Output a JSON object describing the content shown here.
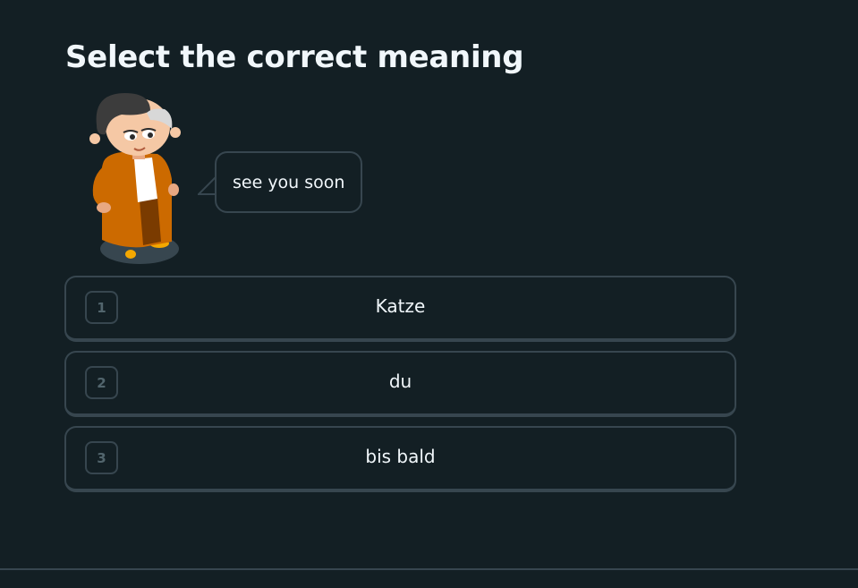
{
  "prompt": {
    "title": "Select the correct meaning",
    "speech_bubble_text": "see you soon"
  },
  "character": {
    "icon": "character-woman-orange-jacket"
  },
  "options": [
    {
      "key": "1",
      "label": "Katze"
    },
    {
      "key": "2",
      "label": "du"
    },
    {
      "key": "3",
      "label": "bis bald"
    }
  ],
  "colors": {
    "background": "#131f24",
    "border": "#37464f",
    "text": "#f1f7fb",
    "key_text": "#52656d",
    "jacket": "#cc6a00"
  }
}
